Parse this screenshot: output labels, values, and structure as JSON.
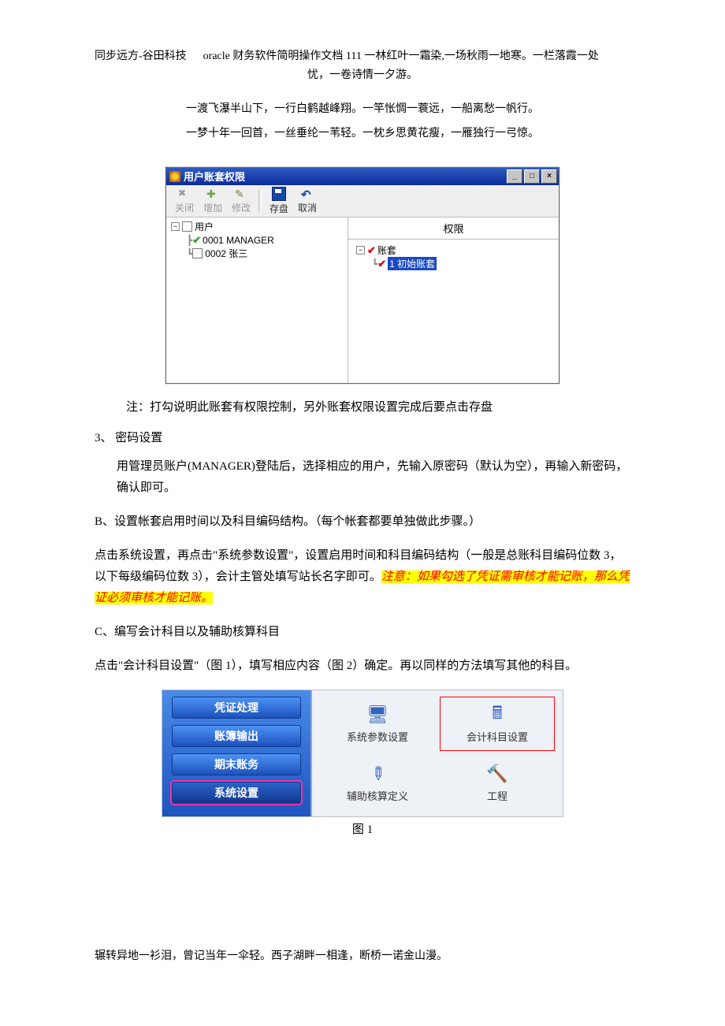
{
  "header": {
    "line1_left": "同步远方-谷田科技",
    "line1_right": "oracle 财务软件简明操作文档 111 一林红叶一霜染,一场秋雨一地寒。一栏落霞一处",
    "line2": "忧，一卷诗情一夕游。"
  },
  "poem": {
    "l1": "一渡飞瀑半山下，一行白鹤越峰翔。一竿怅惆一蓑远，一船离愁一帆行。",
    "l2": "一梦十年一回首，一丝垂纶一苇轻。一枕乡思黄花瘦，一雁独行一弓惊。"
  },
  "window": {
    "title": "用户账套权限",
    "toolbar": {
      "close": "关闭",
      "add": "增加",
      "edit": "修改",
      "save": "存盘",
      "cancel": "取消"
    },
    "left_tree": {
      "root": "用户",
      "u1": "0001 MANAGER",
      "u2": "0002 张三"
    },
    "right": {
      "header": "权限",
      "root": "账套",
      "item": "1 初始账套"
    }
  },
  "body": {
    "note": "注：打勾说明此账套有权限控制，另外账套权限设置完成后要点击存盘",
    "sec3": "3、 密码设置",
    "p3": "用管理员账户(MANAGER)登陆后，选择相应的用户，先输入原密码（默认为空），再输入新密码，确认即可。",
    "secB": "B、设置帐套启用时间以及科目编码结构。（每个帐套都要单独做此步骤。）",
    "pB_1": "点击系统设置，再点击\"系统参数设置\"，设置启用时间和科目编码结构（一般是总账科目编码位数 3，以下每级编码位数 3），会计主管处填写站长名字即可。",
    "pB_hl": "注意：如果勾选了凭证需审核才能记账，那么凭证必须审核才能记账。",
    "secC": "C、编写会计科目以及辅助核算科目",
    "pC": "点击\"会计科目设置\"（图 1），填写相应内容（图 2）确定。再以同样的方法填写其他的科目。"
  },
  "fig1": {
    "nav": {
      "b1": "凭证处理",
      "b2": "账簿输出",
      "b3": "期末账务",
      "b4": "系统设置"
    },
    "icons": {
      "i1": "系统参数设置",
      "i2": "会计科目设置",
      "i3": "辅助核算定义",
      "i4": "工程"
    },
    "caption": "图 1"
  },
  "footer": "辗转异地一衫泪，曾记当年一伞轻。西子湖畔一相逢，断桥一诺金山漫。"
}
